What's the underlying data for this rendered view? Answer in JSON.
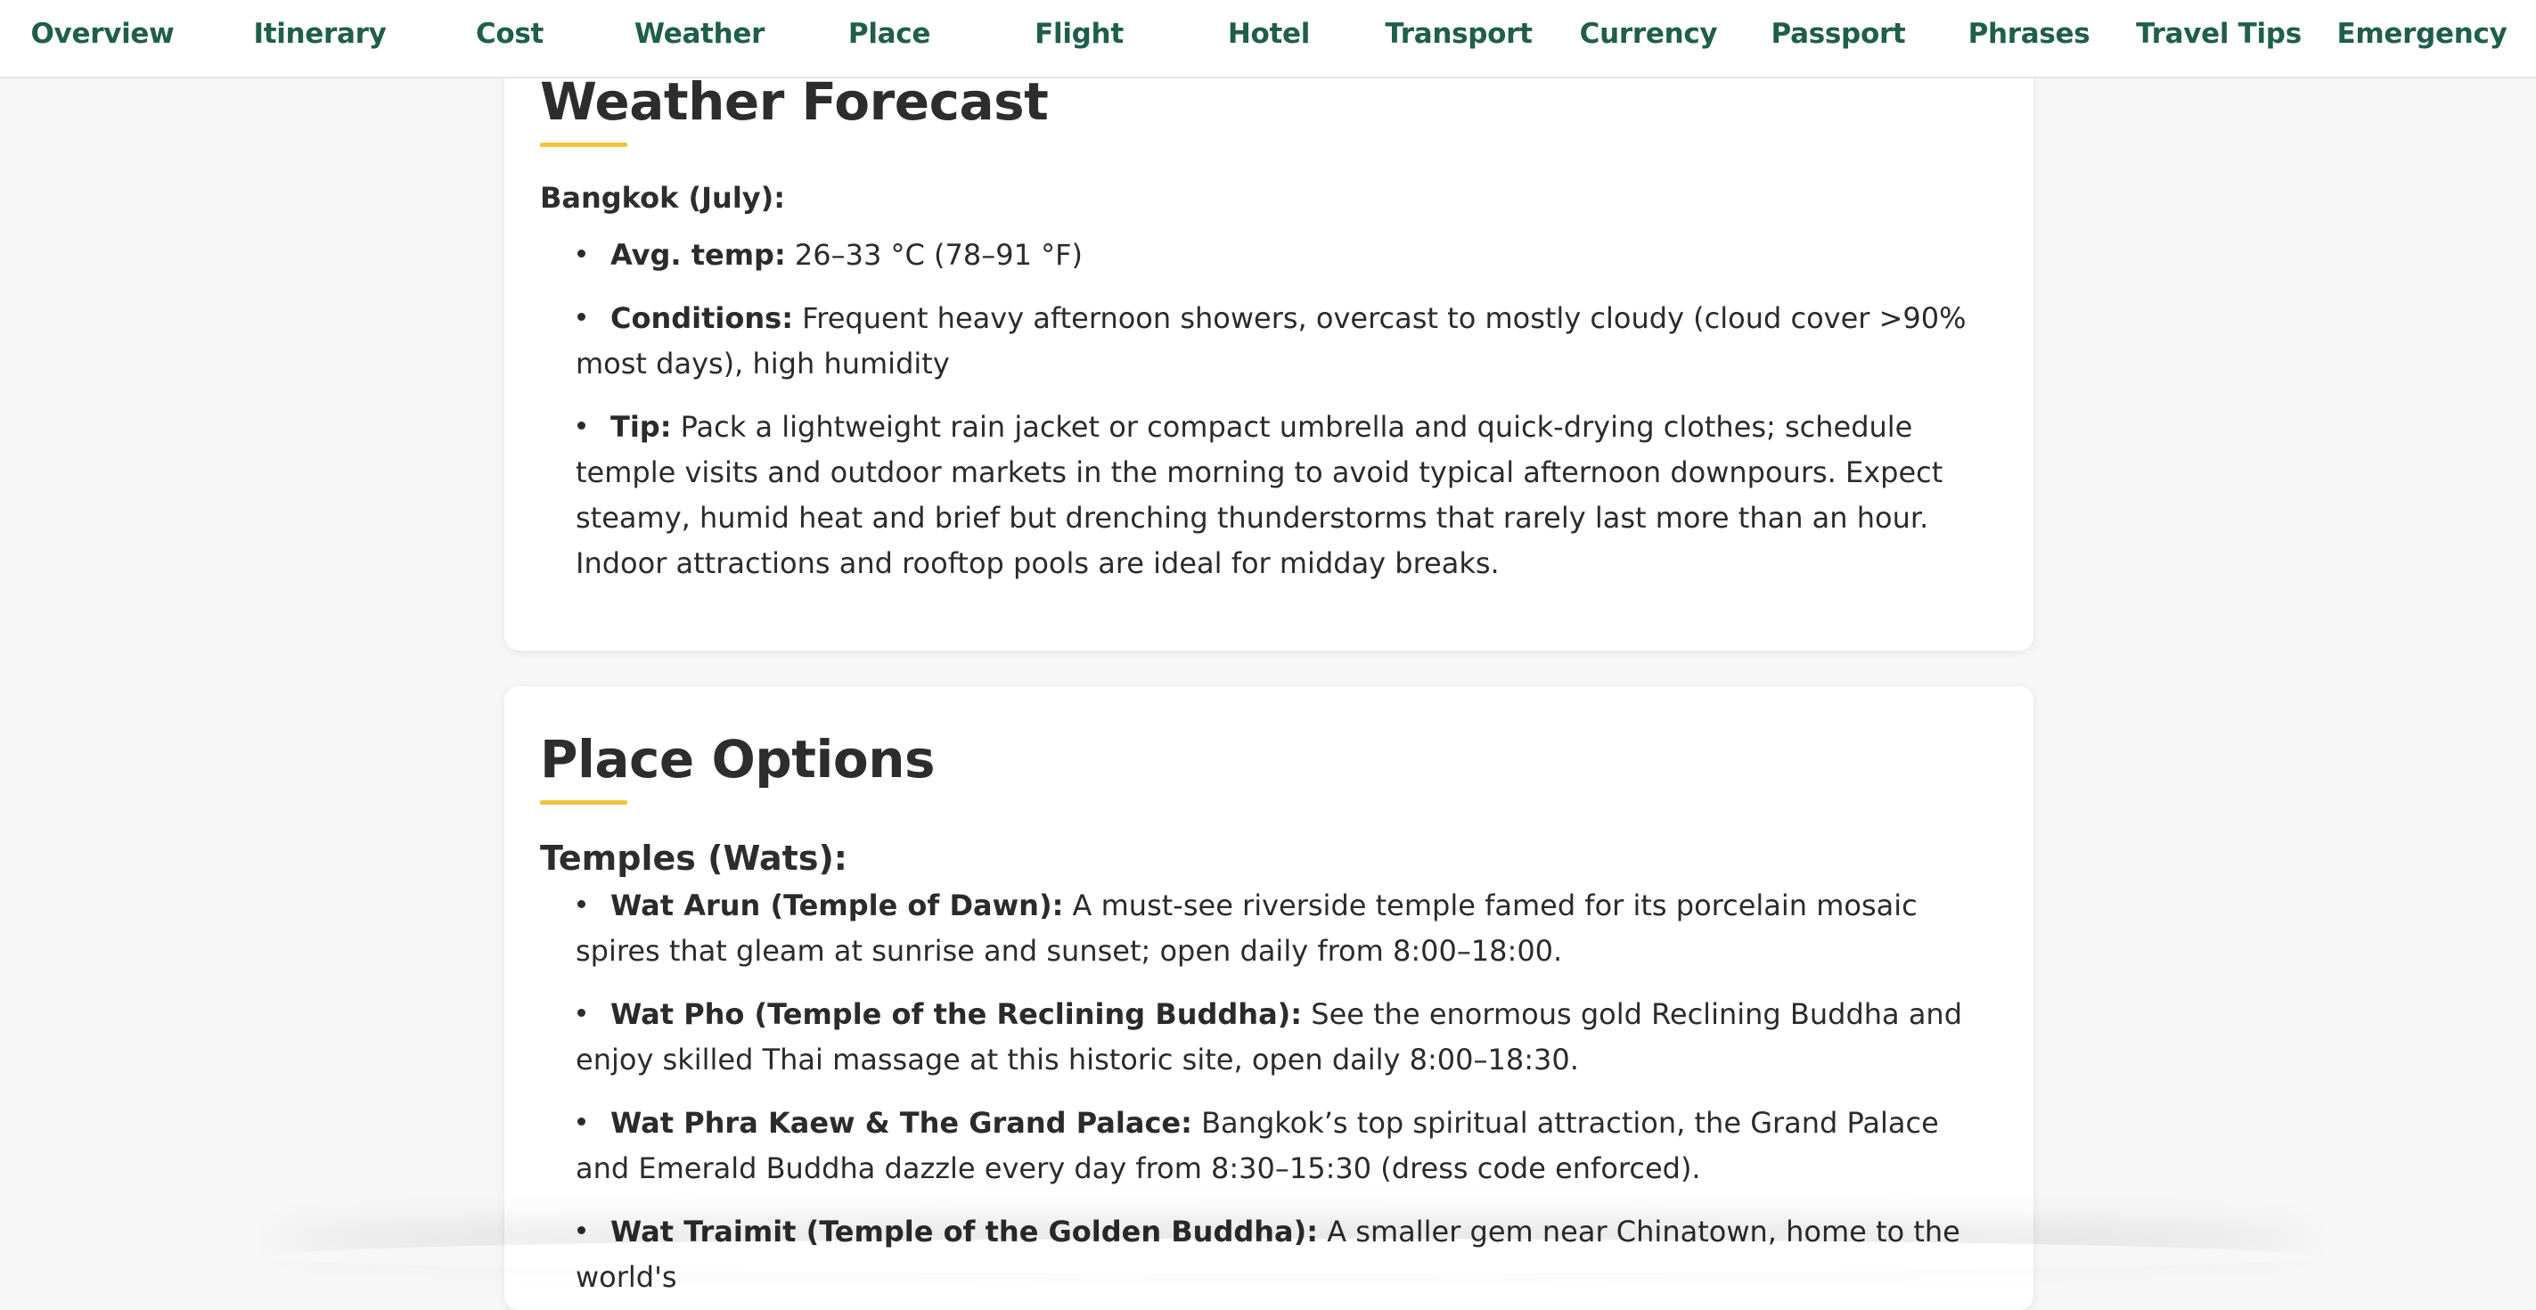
{
  "nav": {
    "items": [
      {
        "label": "Overview"
      },
      {
        "label": "Itinerary"
      },
      {
        "label": "Cost"
      },
      {
        "label": "Weather"
      },
      {
        "label": "Place"
      },
      {
        "label": "Flight"
      },
      {
        "label": "Hotel"
      },
      {
        "label": "Transport"
      },
      {
        "label": "Currency"
      },
      {
        "label": "Passport"
      },
      {
        "label": "Phrases"
      },
      {
        "label": "Travel Tips"
      },
      {
        "label": "Emergency"
      }
    ]
  },
  "weather": {
    "title": "Weather Forecast",
    "location": "Bangkok (July):",
    "items": [
      {
        "label": "Avg. temp:",
        "text": " 26–33 °C (78–91 °F)"
      },
      {
        "label": "Conditions:",
        "text": " Frequent heavy afternoon showers, overcast to mostly cloudy (cloud cover >90% most days), high humidity"
      },
      {
        "label": "Tip:",
        "text": " Pack a lightweight rain jacket or compact umbrella and quick-drying clothes; schedule temple visits and outdoor markets in the morning to avoid typical afternoon downpours. Expect steamy, humid heat and brief but drenching thunderstorms that rarely last more than an hour. Indoor attractions and rooftop pools are ideal for midday breaks."
      }
    ]
  },
  "places": {
    "title": "Place Options",
    "group_title": "Temples (Wats):",
    "items": [
      {
        "label": "Wat Arun (Temple of Dawn):",
        "text": " A must-see riverside temple famed for its porcelain mosaic spires that gleam at sunrise and sunset; open daily from 8:00–18:00."
      },
      {
        "label": "Wat Pho (Temple of the Reclining Buddha):",
        "text": " See the enormous gold Reclining Buddha and enjoy skilled Thai massage at this historic site, open daily 8:00–18:30."
      },
      {
        "label": "Wat Phra Kaew & The Grand Palace:",
        "text": " Bangkok’s top spiritual attraction, the Grand Palace and Emerald Buddha dazzle every day from 8:30–15:30 (dress code enforced)."
      },
      {
        "label": "Wat Traimit (Temple of the Golden Buddha):",
        "text": " A smaller gem near Chinatown, home to the world's"
      }
    ]
  }
}
